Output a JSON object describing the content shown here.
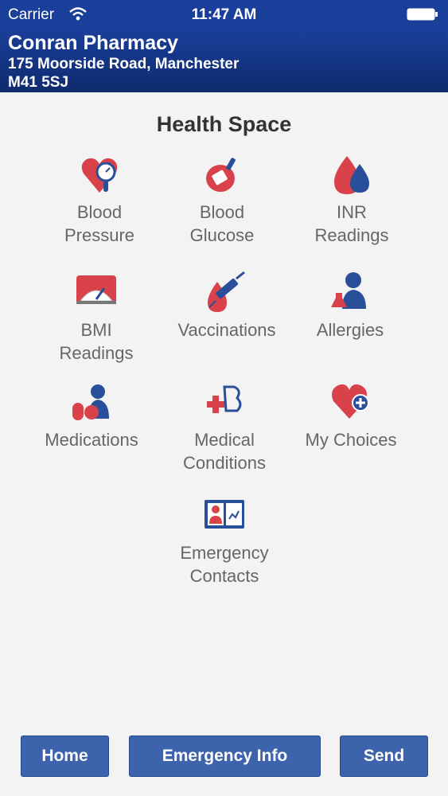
{
  "status_bar": {
    "carrier": "Carrier",
    "time": "11:47 AM"
  },
  "header": {
    "pharmacy_name": "Conran Pharmacy",
    "address_line1": "175 Moorside Road, Manchester",
    "address_line2": "M41 5SJ"
  },
  "page_title": "Health Space",
  "tiles": [
    {
      "label": "Blood\nPressure",
      "icon": "blood-pressure-icon"
    },
    {
      "label": "Blood\nGlucose",
      "icon": "glucose-meter-icon"
    },
    {
      "label": "INR\nReadings",
      "icon": "blood-drop-icon"
    },
    {
      "label": "BMI\nReadings",
      "icon": "scale-gauge-icon"
    },
    {
      "label": "Vaccinations",
      "icon": "syringe-icon"
    },
    {
      "label": "Allergies",
      "icon": "allergy-icon"
    },
    {
      "label": "Medications",
      "icon": "pills-icon"
    },
    {
      "label": "Medical\nConditions",
      "icon": "medical-cross-icon"
    },
    {
      "label": "My Choices",
      "icon": "heart-plus-icon"
    },
    {
      "label": "Emergency\nContacts",
      "icon": "contacts-icon"
    }
  ],
  "bottom_bar": {
    "home": "Home",
    "emergency_info": "Emergency Info",
    "send": "Send"
  },
  "colors": {
    "brand_blue": "#1a3f9a",
    "accent_red": "#d9424a",
    "icon_blue": "#2a4f9a",
    "button_blue": "#3d63ad"
  }
}
